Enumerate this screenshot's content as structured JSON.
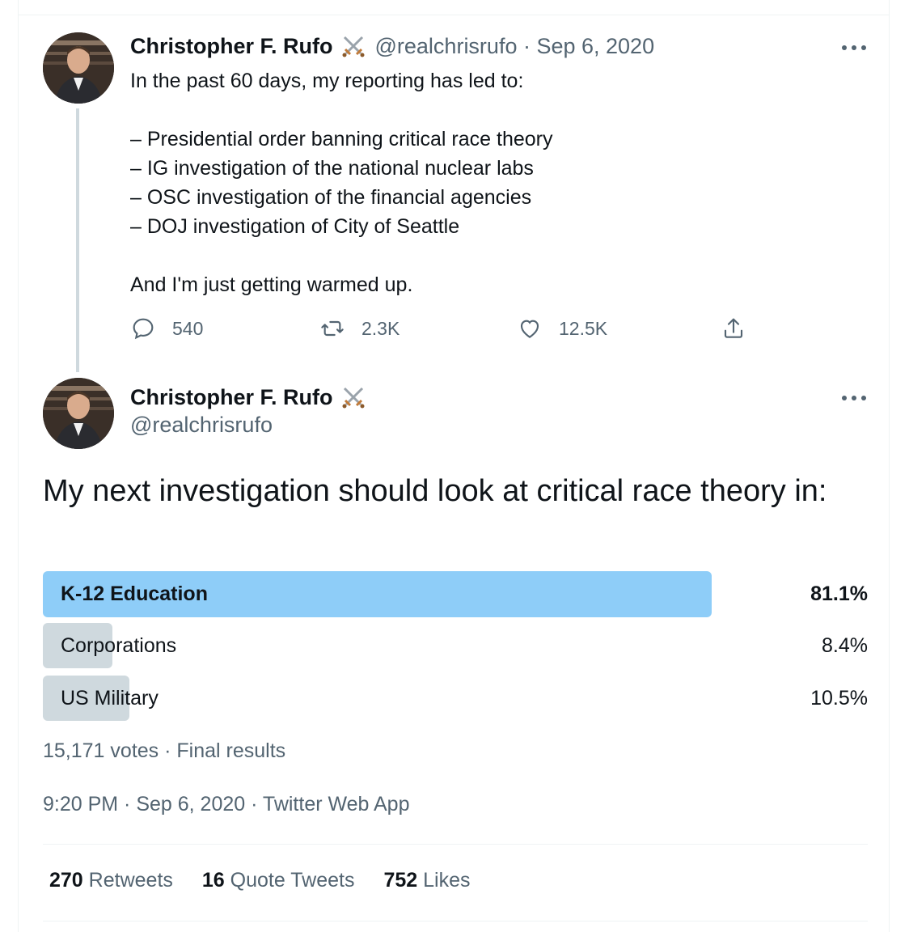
{
  "tweet1": {
    "name": "Christopher F. Rufo",
    "badge_icon": "crossed-swords",
    "handle_date": "@realchrisrufo · Sep 6, 2020",
    "text_lines": [
      "In the past 60 days, my reporting has led to:",
      "",
      "– Presidential order banning critical race theory",
      "– IG investigation of the national nuclear labs",
      "– OSC investigation of the financial agencies",
      "– DOJ investigation of City of Seattle",
      "",
      "And I'm just getting warmed up."
    ],
    "actions": {
      "replies": "540",
      "retweets": "2.3K",
      "likes": "12.5K"
    }
  },
  "tweet2": {
    "name": "Christopher F. Rufo",
    "handle": "@realchrisrufo",
    "poll": {
      "question": "My next investigation should look at critical race theory in:",
      "options": [
        {
          "label": "K-12 Education",
          "percent": "81.1%",
          "fraction": 0.811,
          "winner": true
        },
        {
          "label": "Corporations",
          "percent": "8.4%",
          "fraction": 0.084,
          "winner": false
        },
        {
          "label": "US Military",
          "percent": "10.5%",
          "fraction": 0.105,
          "winner": false
        }
      ],
      "meta": "15,171 votes · Final results"
    },
    "timestamp": "9:20 PM · Sep 6, 2020 · Twitter Web App",
    "stats": {
      "retweets_count": "270",
      "retweets_label": "Retweets",
      "quotes_count": "16",
      "quotes_label": "Quote Tweets",
      "likes_count": "752",
      "likes_label": "Likes"
    }
  },
  "colors": {
    "text": "#0f1419",
    "muted": "#536471",
    "poll_winner": "#8ecdf8",
    "poll_other": "#cfd9de",
    "border": "#eff3f4"
  }
}
